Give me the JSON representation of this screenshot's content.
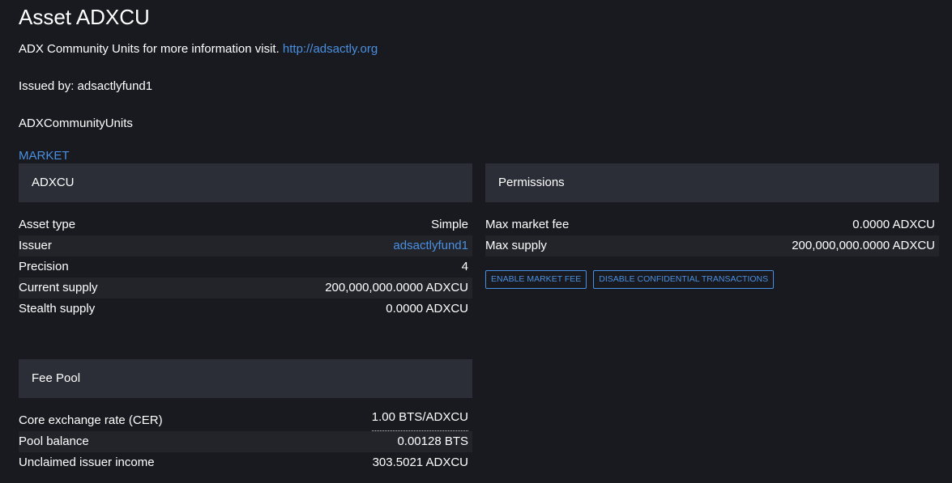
{
  "header": {
    "title": "Asset ADXCU",
    "description_text": "ADX Community Units for more information visit. ",
    "description_link": "http://adsactly.org",
    "issued_by": "Issued by: adsactlyfund1",
    "long_name": "ADXCommunityUnits",
    "market_link": "MARKET"
  },
  "summary": {
    "heading": "ADXCU",
    "rows": [
      {
        "label": "Asset type",
        "value": "Simple"
      },
      {
        "label": "Issuer",
        "value": "adsactlyfund1"
      },
      {
        "label": "Precision",
        "value": "4"
      },
      {
        "label": "Current supply",
        "value": "200,000,000.0000 ADXCU"
      },
      {
        "label": "Stealth supply",
        "value": "0.0000 ADXCU"
      }
    ]
  },
  "permissions": {
    "heading": "Permissions",
    "rows": [
      {
        "label": "Max market fee",
        "value": "0.0000 ADXCU"
      },
      {
        "label": "Max supply",
        "value": "200,000,000.0000 ADXCU"
      }
    ],
    "buttons": {
      "enable_market_fee": "ENABLE MARKET FEE",
      "disable_confidential": "DISABLE CONFIDENTIAL TRANSACTIONS"
    }
  },
  "fee_pool": {
    "heading": "Fee Pool",
    "rows": [
      {
        "label": "Core exchange rate (CER)",
        "value": "1.00 BTS/ADXCU"
      },
      {
        "label": "Pool balance",
        "value": "0.00128 BTS"
      },
      {
        "label": "Unclaimed issuer income",
        "value": "303.5021 ADXCU"
      }
    ]
  },
  "colors": {
    "background": "#191a1f",
    "panel_header": "#2b2e36",
    "link": "#4a90e2"
  }
}
